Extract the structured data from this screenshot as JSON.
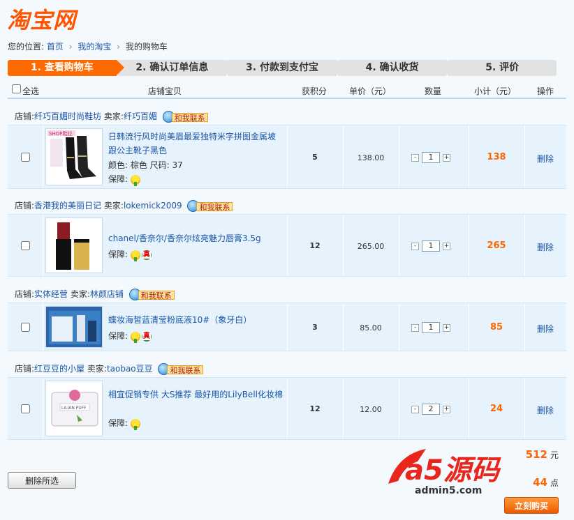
{
  "logo": "淘宝网",
  "breadcrumb": {
    "label": "您的位置:",
    "items": [
      "首页",
      "我的淘宝",
      "我的购物车"
    ]
  },
  "steps": [
    "1. 查看购物车",
    "2. 确认订单信息",
    "3. 付款到支付宝",
    "4. 确认收货",
    "5. 评价"
  ],
  "table_header": {
    "select_all": "全选",
    "item": "店铺宝贝",
    "points": "获积分",
    "unit_price": "单价（元）",
    "quantity": "数量",
    "subtotal": "小计（元）",
    "action": "操作"
  },
  "labels": {
    "shop": "店铺:",
    "seller": "卖家:",
    "contact": "和我联系",
    "guarantee": "保障:",
    "delete": "删除",
    "qty_minus": "-",
    "qty_plus": "+",
    "zhen": "真"
  },
  "items": [
    {
      "shop": "纤巧百媚时尚鞋坊",
      "seller": "纤巧百媚",
      "title": "日韩流行风时尚美眉最爱独特米字拼图金属坡跟公主靴子黑色",
      "attrs": "颜色: 棕色  尺码: 37",
      "points": "5",
      "price": "138.00",
      "qty": "1",
      "subtotal": "138",
      "img_text": "SHOP鞋拉"
    },
    {
      "shop": "香港我的美丽日记",
      "seller": "lokemick2009",
      "title": "chanel/香奈尔/香奈尔炫亮魅力唇膏3.5g",
      "attrs": "",
      "points": "12",
      "price": "265.00",
      "qty": "1",
      "subtotal": "265",
      "img_text": ""
    },
    {
      "shop": "实体经营",
      "seller": "林颜店铺",
      "title": "蝶妆海皙蓝清莹粉底液10#（象牙白）",
      "attrs": "",
      "points": "3",
      "price": "85.00",
      "qty": "1",
      "subtotal": "85",
      "img_text": ""
    },
    {
      "shop": "红豆豆的小屋",
      "seller": "taobao豆豆",
      "title": "相宜促销专供 大S推荐 最好用的LilyBell化妆棉",
      "attrs": "",
      "points": "12",
      "price": "12.00",
      "qty": "2",
      "subtotal": "24",
      "img_text": "LILIAN PUFF"
    }
  ],
  "footer": {
    "delete_selected": "删除所选",
    "total_value": "512",
    "total_unit": "元",
    "points_value": "44",
    "points_unit": "点",
    "buy_now": "立刻购买"
  },
  "watermark": {
    "brand": "a5源码",
    "url": "admin5.com"
  },
  "colors": {
    "accent": "#ff6600",
    "link": "#1a55a5",
    "row_bg": "#e7f3fc"
  }
}
